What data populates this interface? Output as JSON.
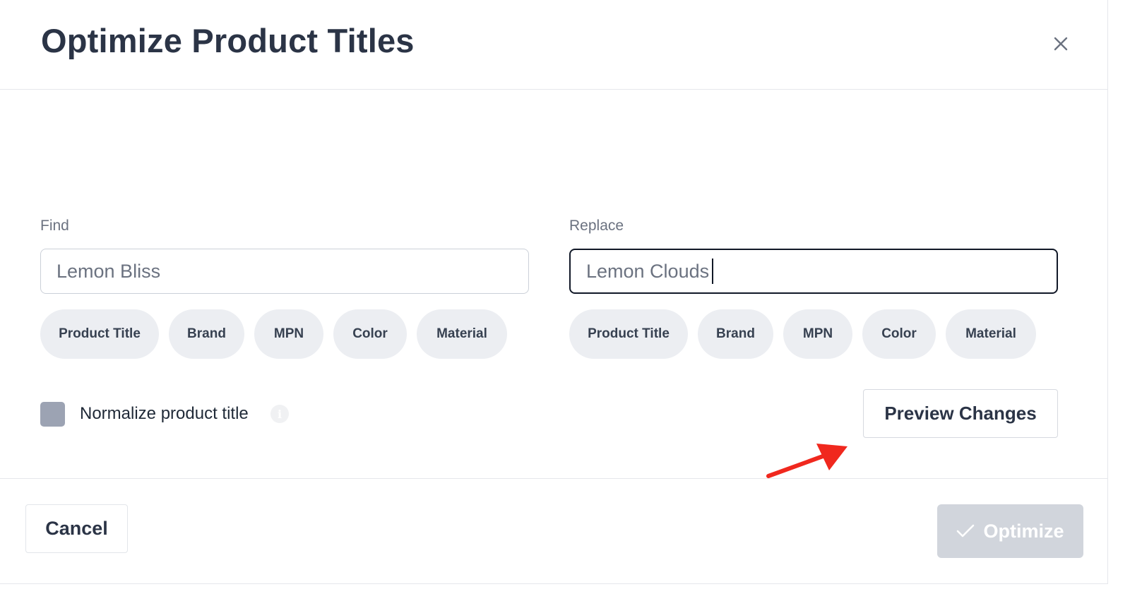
{
  "modal": {
    "title": "Optimize Product Titles",
    "close_icon": "close-icon"
  },
  "find": {
    "label": "Find",
    "value": "Lemon Bliss",
    "chips": [
      "Product Title",
      "Brand",
      "MPN",
      "Color",
      "Material"
    ]
  },
  "replace": {
    "label": "Replace",
    "value": "Lemon Clouds",
    "chips": [
      "Product Title",
      "Brand",
      "MPN",
      "Color",
      "Material"
    ]
  },
  "normalize": {
    "label": "Normalize product title",
    "checked": false,
    "info_icon": "info-icon"
  },
  "preview_button": {
    "label": "Preview Changes"
  },
  "annotation": {
    "type": "arrow",
    "color": "#f0281e",
    "points_to": "preview-changes-button"
  },
  "footer": {
    "cancel_label": "Cancel",
    "optimize_label": "Optimize",
    "optimize_icon": "checkmark-icon",
    "optimize_disabled": true
  },
  "colors": {
    "title": "#2b3446",
    "chip_bg": "#eceef2",
    "checkbox": "#9ca3b3",
    "optimize_disabled_bg": "#d1d5dc",
    "annotation_arrow": "#f0281e"
  }
}
